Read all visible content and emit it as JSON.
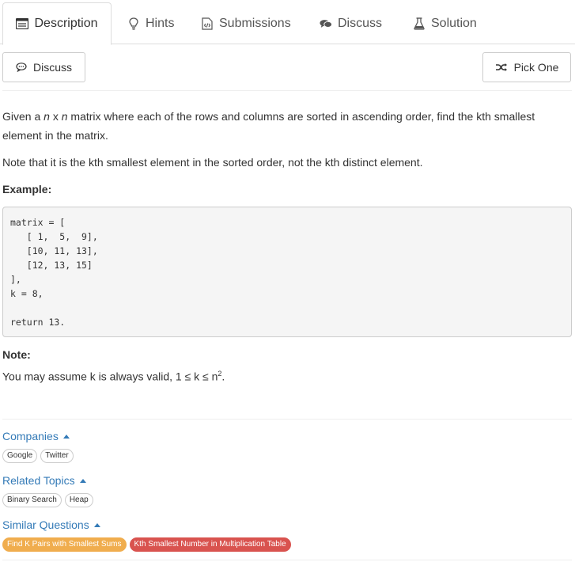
{
  "tabs": [
    {
      "label": "Description",
      "icon": "description-icon"
    },
    {
      "label": "Hints",
      "icon": "lightbulb-icon"
    },
    {
      "label": "Submissions",
      "icon": "code-file-icon"
    },
    {
      "label": "Discuss",
      "icon": "comments-icon"
    },
    {
      "label": "Solution",
      "icon": "flask-icon"
    }
  ],
  "toolbar": {
    "discuss_label": "Discuss",
    "pick_one_label": "Pick One"
  },
  "problem": {
    "para1_pre": "Given a ",
    "para1_n1": "n",
    "para1_x": " x ",
    "para1_n2": "n",
    "para1_post": " matrix where each of the rows and columns are sorted in ascending order, find the kth smallest element in the matrix.",
    "para2": "Note that it is the kth smallest element in the sorted order, not the kth distinct element.",
    "example_heading": "Example:",
    "example_code": "matrix = [\n   [ 1,  5,  9],\n   [10, 11, 13],\n   [12, 13, 15]\n],\nk = 8,\n\nreturn 13.",
    "note_heading": "Note:",
    "note_text": "You may assume k is always valid, 1 ≤ k ≤ n",
    "note_sup": "2",
    "note_end": "."
  },
  "companies": {
    "title": "Companies",
    "tags": [
      "Google",
      "Twitter"
    ]
  },
  "related_topics": {
    "title": "Related Topics",
    "tags": [
      "Binary Search",
      "Heap"
    ]
  },
  "similar_questions": {
    "title": "Similar Questions",
    "items": [
      {
        "label": "Find K Pairs with Smallest Sums",
        "difficulty_color": "#f0ad4e"
      },
      {
        "label": "Kth Smallest Number in Multiplication Table",
        "difficulty_color": "#d9534f"
      }
    ]
  }
}
